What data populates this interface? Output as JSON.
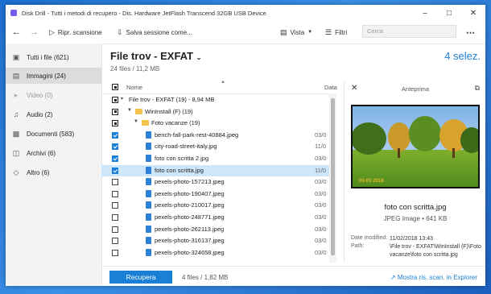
{
  "window": {
    "title": "Disk Drill - Tutti i metodi di recupero - Dis. Hardware JetFlash Transcend 32GB USB Device",
    "accent": "#1a7fd6"
  },
  "toolbar": {
    "rescan_label": "Ripr. scansione",
    "save_session_label": "Salva sessione come...",
    "view_label": "Vista",
    "filters_label": "Filtri",
    "search_placeholder": "Cerca"
  },
  "sidebar": {
    "items": [
      {
        "label": "Tutti i file (621)",
        "icon": "files-icon",
        "state": "normal"
      },
      {
        "label": "Immagini (24)",
        "icon": "image-icon",
        "state": "selected"
      },
      {
        "label": "Video (0)",
        "icon": "video-icon",
        "state": "disabled"
      },
      {
        "label": "Audio (2)",
        "icon": "music-icon",
        "state": "normal"
      },
      {
        "label": "Documenti (583)",
        "icon": "document-icon",
        "state": "normal"
      },
      {
        "label": "Archivi (6)",
        "icon": "archive-icon",
        "state": "normal"
      },
      {
        "label": "Altro (6)",
        "icon": "other-icon",
        "state": "normal"
      }
    ]
  },
  "header": {
    "title": "File trov - EXFAT",
    "subtitle": "24 files / 11,2 MB",
    "selected_count": "4 selez."
  },
  "list": {
    "col_name": "Nome",
    "col_date": "Data",
    "rows": [
      {
        "kind": "group",
        "label": "File trov - EXFAT (19) - 8,94 MB",
        "check": "part",
        "date": ""
      },
      {
        "kind": "folder",
        "label": "WinInstall (F) (19)",
        "check": "part",
        "date": ""
      },
      {
        "kind": "folder2",
        "label": "Foto vacanze (19)",
        "check": "part",
        "date": ""
      },
      {
        "kind": "file",
        "label": "bench-fall-park-rest-40884.jpeg",
        "check": "on",
        "date": "03/0"
      },
      {
        "kind": "file",
        "label": "city-road-street-italy.jpg",
        "check": "on",
        "date": "11/0"
      },
      {
        "kind": "file",
        "label": "foto con scritta 2.jpg",
        "check": "on",
        "date": "03/0"
      },
      {
        "kind": "file",
        "label": "foto con scritta.jpg",
        "check": "on",
        "date": "11/0",
        "selected": true
      },
      {
        "kind": "file",
        "label": "pexels-photo-157213.jpeg",
        "check": "off",
        "date": "03/0"
      },
      {
        "kind": "file",
        "label": "pexels-photo-190407.jpeg",
        "check": "off",
        "date": "03/0"
      },
      {
        "kind": "file",
        "label": "pexels-photo-210017.jpeg",
        "check": "off",
        "date": "03/0"
      },
      {
        "kind": "file",
        "label": "pexels-photo-248771.jpeg",
        "check": "off",
        "date": "03/0"
      },
      {
        "kind": "file",
        "label": "pexels-photo-262113.jpeg",
        "check": "off",
        "date": "03/0"
      },
      {
        "kind": "file",
        "label": "pexels-photo-316137.jpeg",
        "check": "off",
        "date": "03/0"
      },
      {
        "kind": "file",
        "label": "pexels-photo-324658.jpeg",
        "check": "off",
        "date": "03/0"
      }
    ]
  },
  "preview": {
    "title": "Anteprima",
    "filename": "foto con scritta.jpg",
    "type_size": "JPEG Image • 641 KB",
    "image_caption": "03-01-2018",
    "date_label": "Date modified:",
    "date_value": "11/02/2018 13:43",
    "path_label": "Path:",
    "path_value_1": "\\File trov - EXFAT\\WinInstall (F)\\Foto",
    "path_value_2": "vacanze\\foto con scritta.jpg"
  },
  "footer": {
    "recover_label": "Recupera",
    "summary": "4 files / 1,82 MB",
    "explorer_link": "Mostra ris. scan. in Explorer"
  }
}
